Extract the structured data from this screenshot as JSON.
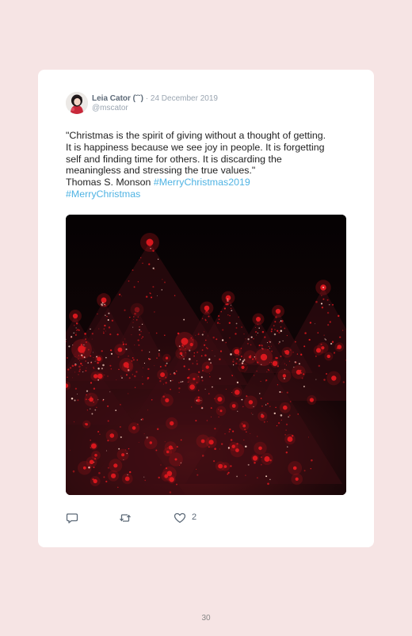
{
  "tweet": {
    "display_name": "Leia Cator (˘˘)",
    "separator": "·",
    "date": "24 December 2019",
    "handle": "@mscator",
    "text_lines": [
      "\"Christmas is the spirit of giving without a thought of getting.",
      "It is happiness because we see joy in people. It is forgetting",
      "self and finding time for others. It is discarding the",
      "meaningless and stressing the true values.\""
    ],
    "author_line": "Thomas S. Monson",
    "hashtags": [
      "#MerryChristmas2019",
      "#MerryChristmas"
    ],
    "media": {
      "icon": "christmas-trees-photo",
      "accent_color": "#d8181e"
    },
    "actions": {
      "reply_icon": "reply-icon",
      "retweet_icon": "retweet-icon",
      "like_icon": "heart-icon",
      "like_count": "2"
    }
  },
  "page": {
    "number": "30",
    "background_color": "#f6e4e4",
    "link_color": "#4fb3e3"
  }
}
